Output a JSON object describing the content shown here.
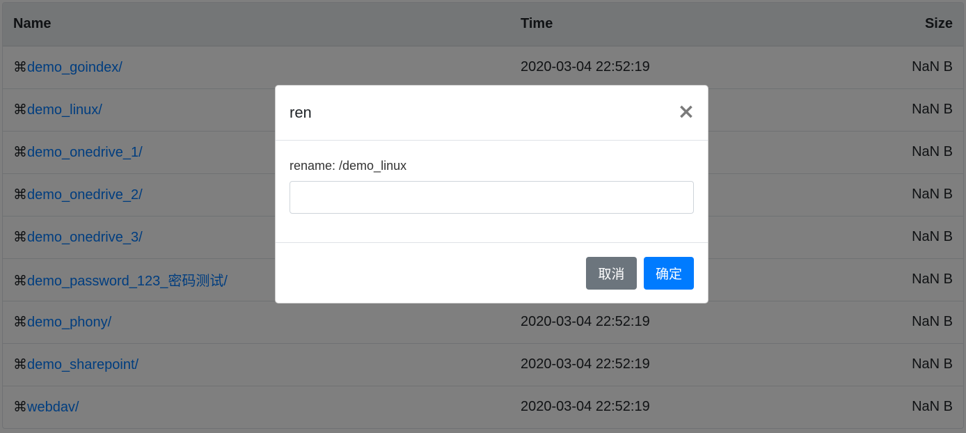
{
  "table": {
    "headers": {
      "name": "Name",
      "time": "Time",
      "size": "Size"
    },
    "rows": [
      {
        "icon": "⌘",
        "name": "demo_goindex/",
        "time": "2020-03-04 22:52:19",
        "size": "NaN B"
      },
      {
        "icon": "⌘",
        "name": "demo_linux/",
        "time": "",
        "size": "NaN B"
      },
      {
        "icon": "⌘",
        "name": "demo_onedrive_1/",
        "time": "",
        "size": "NaN B"
      },
      {
        "icon": "⌘",
        "name": "demo_onedrive_2/",
        "time": "",
        "size": "NaN B"
      },
      {
        "icon": "⌘",
        "name": "demo_onedrive_3/",
        "time": "",
        "size": "NaN B"
      },
      {
        "icon": "⌘",
        "name": "demo_password_123_密码测试/",
        "time": "",
        "size": "NaN B"
      },
      {
        "icon": "⌘",
        "name": "demo_phony/",
        "time": "2020-03-04 22:52:19",
        "size": "NaN B"
      },
      {
        "icon": "⌘",
        "name": "demo_sharepoint/",
        "time": "2020-03-04 22:52:19",
        "size": "NaN B"
      },
      {
        "icon": "⌘",
        "name": "webdav/",
        "time": "2020-03-04 22:52:19",
        "size": "NaN B"
      }
    ]
  },
  "modal": {
    "title": "ren",
    "close_symbol": "×",
    "label": "rename: /demo_linux",
    "input_value": "",
    "input_placeholder": "",
    "cancel_label": "取消",
    "ok_label": "确定"
  },
  "colors": {
    "link": "#007bff",
    "primary": "#007bff",
    "secondary": "#6c757d",
    "header_bg": "#e9ecef"
  }
}
